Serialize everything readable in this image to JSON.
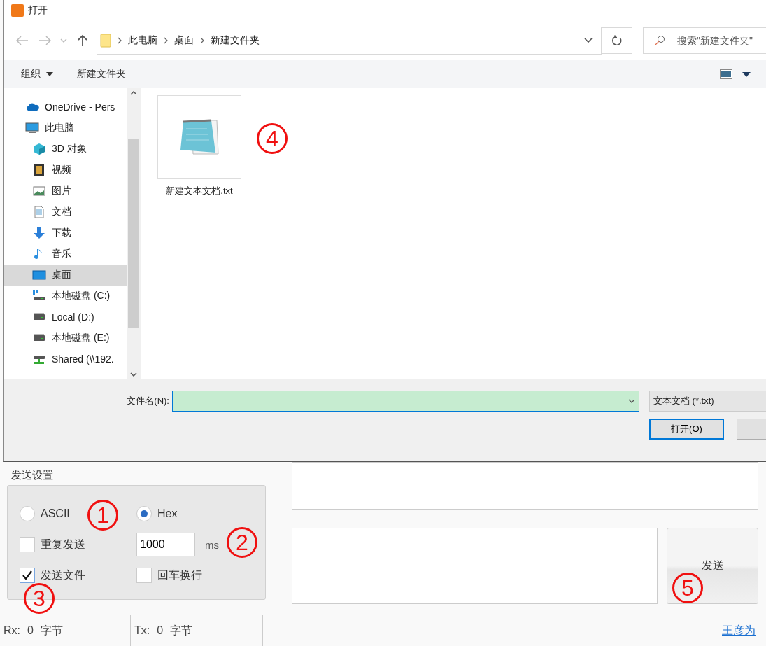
{
  "dialog": {
    "title": "打开",
    "nav": {
      "breadcrumbs": [
        "此电脑",
        "桌面",
        "新建文件夹"
      ],
      "search": {
        "placeholder": "搜索\"新建文件夹\""
      }
    },
    "toolbar": {
      "organize": "组织",
      "new_folder": "新建文件夹"
    },
    "sidebar": {
      "items": [
        {
          "label": "OneDrive - Pers",
          "kind": "cloud",
          "selected": false
        },
        {
          "label": "此电脑",
          "kind": "pc",
          "selected": false,
          "children": [
            {
              "label": "3D 对象",
              "kind": "cube",
              "selected": false
            },
            {
              "label": "视频",
              "kind": "video",
              "selected": false
            },
            {
              "label": "图片",
              "kind": "picture",
              "selected": false
            },
            {
              "label": "文档",
              "kind": "document",
              "selected": false
            },
            {
              "label": "下载",
              "kind": "download",
              "selected": false
            },
            {
              "label": "音乐",
              "kind": "music",
              "selected": false
            },
            {
              "label": "桌面",
              "kind": "desktop",
              "selected": true
            },
            {
              "label": "本地磁盘 (C:)",
              "kind": "system-drive",
              "selected": false
            },
            {
              "label": "Local (D:)",
              "kind": "drive",
              "selected": false
            },
            {
              "label": "本地磁盘 (E:)",
              "kind": "drive",
              "selected": false
            },
            {
              "label": "Shared (\\\\192.",
              "kind": "network-drive",
              "selected": false
            }
          ]
        }
      ]
    },
    "files": [
      {
        "name": "新建文本文档.txt",
        "kind": "text"
      }
    ],
    "filename": {
      "label": "文件名(N):"
    },
    "file_type": "文本文档 (*.txt)",
    "open_button": "打开(O)"
  },
  "send_settings": {
    "title": "发送设置",
    "formats": [
      {
        "label": "ASCII",
        "selected": false
      },
      {
        "label": "Hex",
        "selected": true
      }
    ],
    "repeat": {
      "label": "重复发送",
      "checked": false
    },
    "interval": {
      "value": "1000",
      "unit": "ms"
    },
    "send_file": {
      "label": "发送文件",
      "checked": true
    },
    "newline": {
      "label": "回车换行",
      "checked": false
    }
  },
  "send_button": "发送",
  "status_bar": {
    "rx": {
      "label": "Rx:",
      "count": "0",
      "unit": "字节"
    },
    "tx": {
      "label": "Tx:",
      "count": "0",
      "unit": "字节"
    },
    "author_link": "王彦为"
  },
  "annotations": [
    {
      "number": "1"
    },
    {
      "number": "2"
    },
    {
      "number": "3"
    },
    {
      "number": "4"
    },
    {
      "number": "5"
    }
  ]
}
